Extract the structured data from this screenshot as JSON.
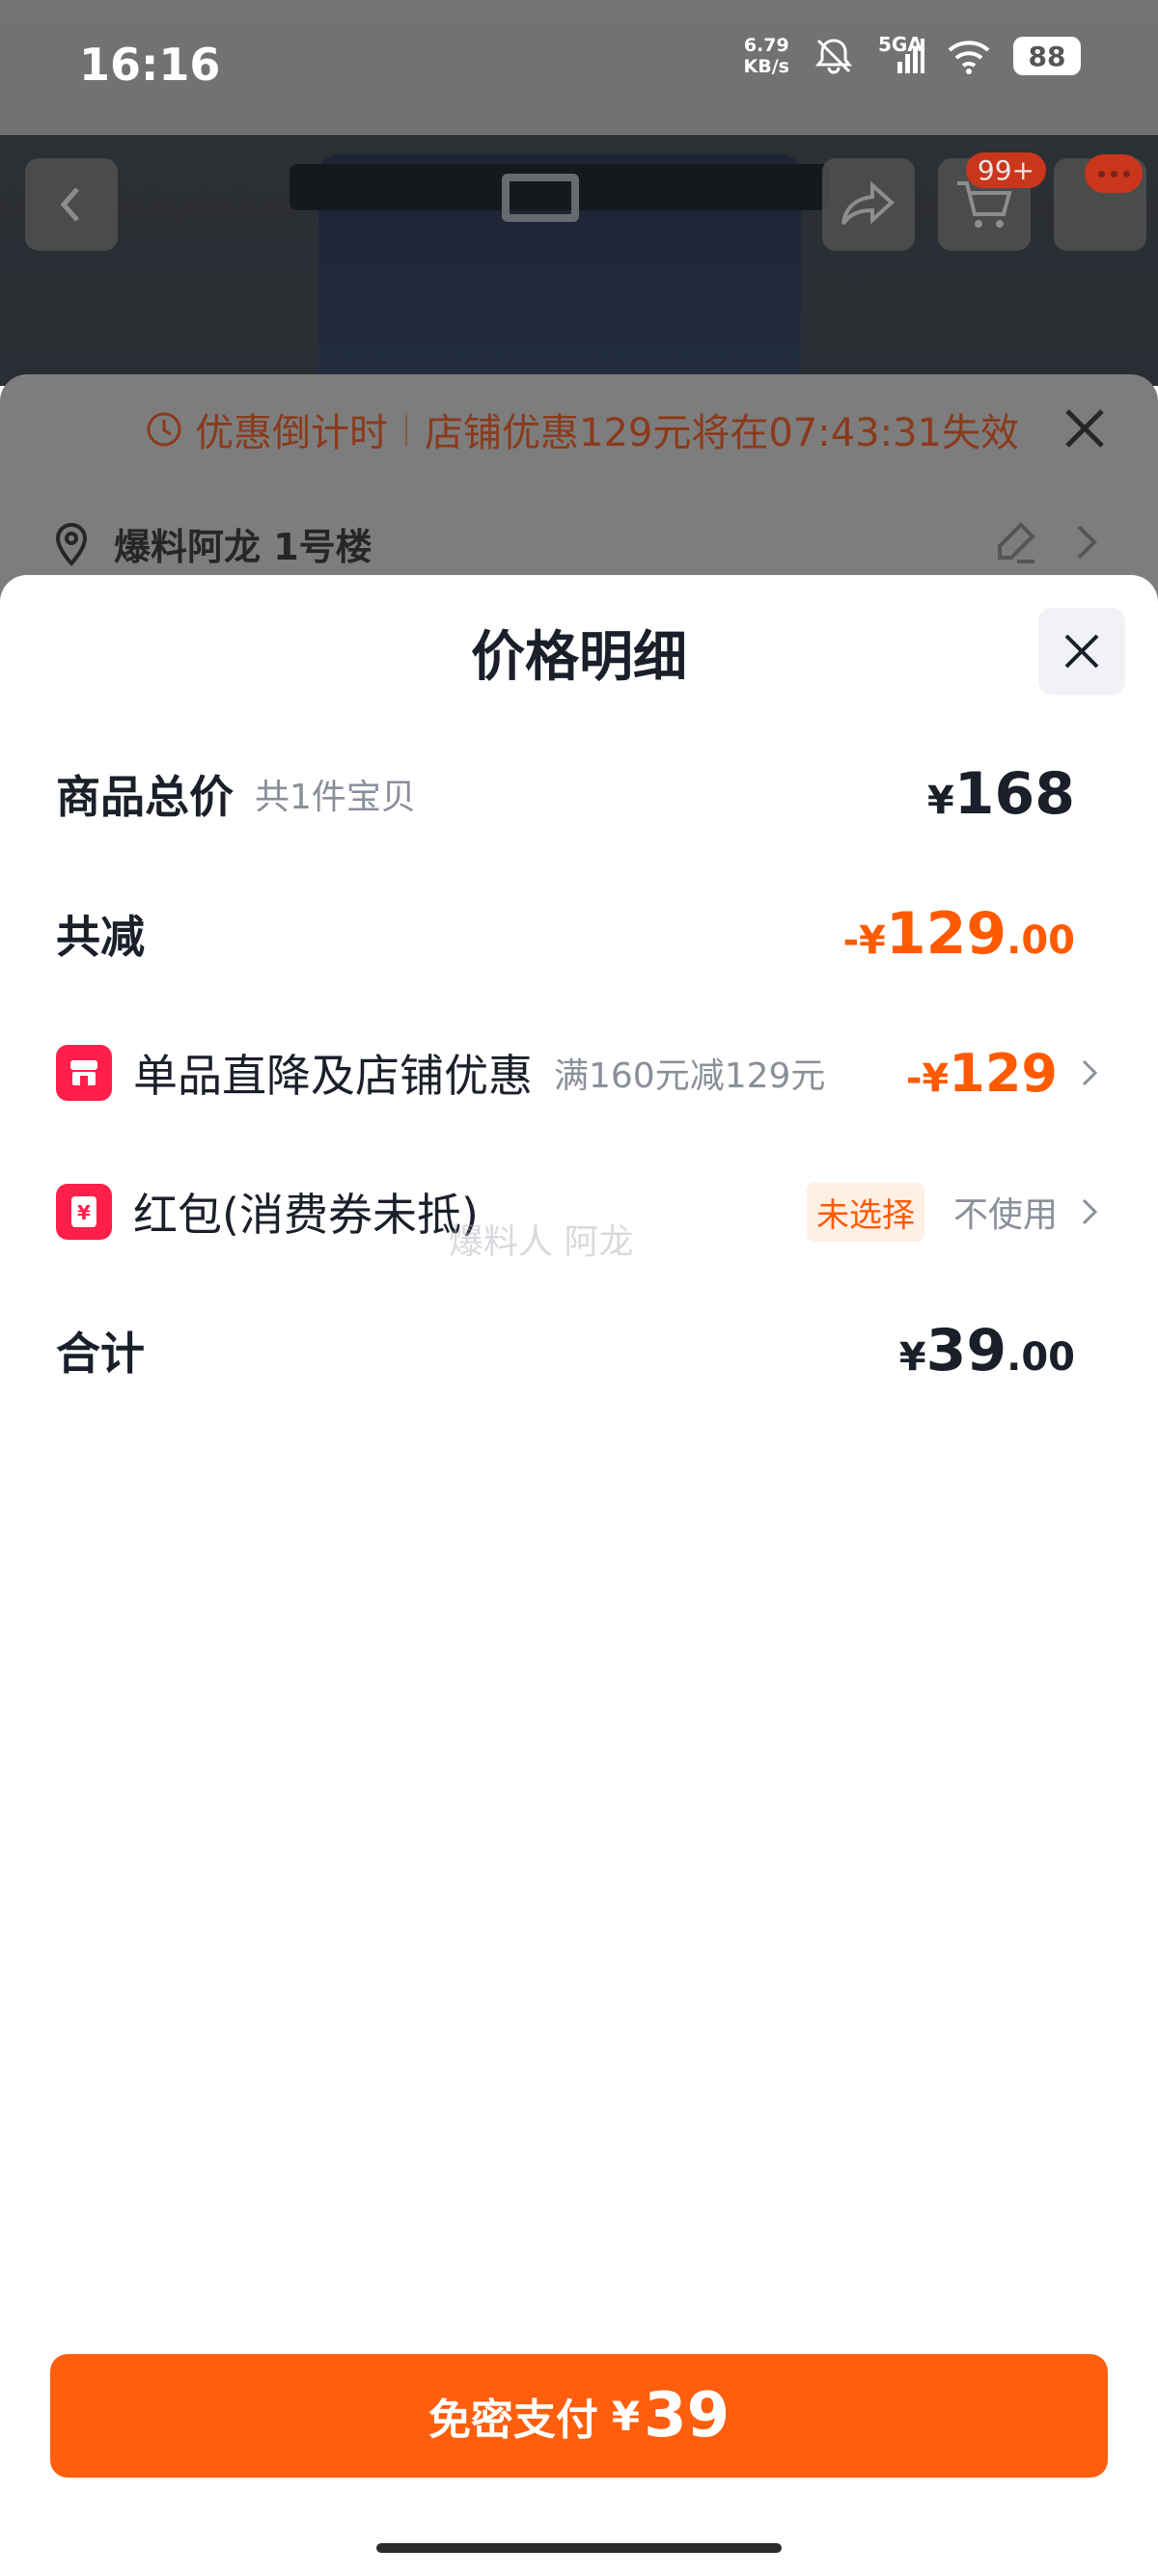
{
  "status_bar": {
    "time": "16:16",
    "net_speed_value": "6.79",
    "net_speed_unit": "KB/s",
    "network_label": "5GA",
    "battery": "88"
  },
  "header": {
    "cart_badge": "99+"
  },
  "promo_banner": {
    "label": "优惠倒计时",
    "message": "店铺优惠129元将在07:43:31失效"
  },
  "address": {
    "text": "爆料阿龙 1号楼"
  },
  "price_sheet": {
    "title": "价格明细",
    "rows": {
      "total": {
        "label": "商品总价",
        "sub": "共1件宝贝",
        "currency": "¥",
        "amount": "168"
      },
      "reduce": {
        "label": "共减",
        "prefix": "-¥",
        "amount": "129",
        "decimal": ".00"
      },
      "discount": {
        "label": "单品直降及店铺优惠",
        "sub": "满160元减129元",
        "prefix": "-¥",
        "amount": "129"
      },
      "red_packet": {
        "label": "红包(消费券未抵)",
        "tag": "未选择",
        "status": "不使用"
      },
      "sum": {
        "label": "合计",
        "currency": "¥",
        "amount": "39",
        "decimal": ".00"
      }
    },
    "watermark": "爆料人 阿龙"
  },
  "pay_button": {
    "label": "免密支付",
    "currency": "¥",
    "amount": "39"
  },
  "colors": {
    "accent_orange": "#ff5e0e",
    "price_orange": "#ff5a00",
    "icon_red": "#ff1f4a"
  }
}
